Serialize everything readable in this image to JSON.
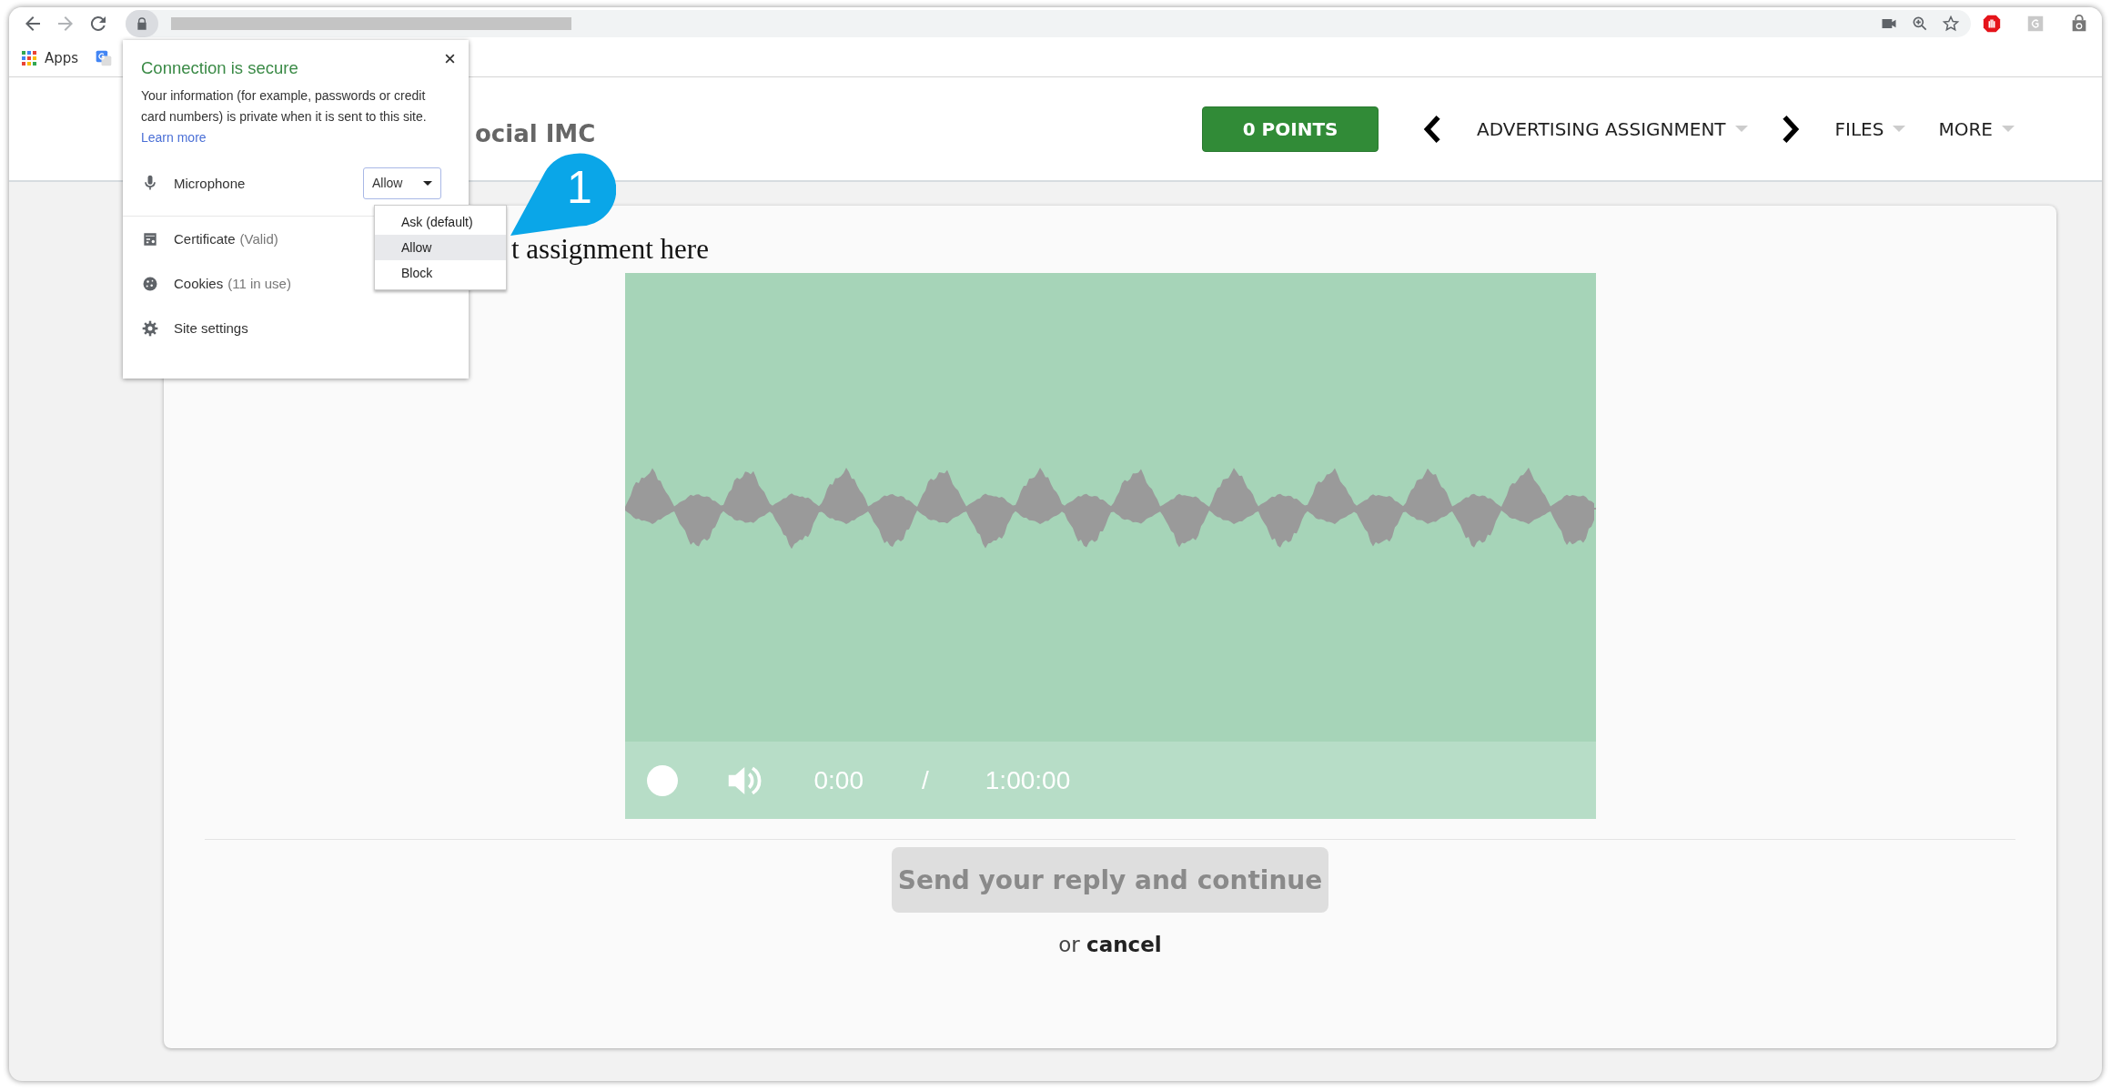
{
  "browser": {
    "bookmarks": [
      {
        "label": "Apps"
      }
    ]
  },
  "header": {
    "title": "ocial IMC",
    "points": "0 POINTS",
    "assignment": "ADVERTISING ASSIGNMENT",
    "menus": [
      {
        "label": "FILES"
      },
      {
        "label": "MORE"
      }
    ]
  },
  "content": {
    "heading": "t assignment here",
    "player": {
      "time_current": "0:00",
      "separator": "/",
      "time_total": "1:00:00"
    },
    "submit": {
      "label": "Send your reply and continue",
      "disabled": true
    },
    "or": "or",
    "cancel": "cancel"
  },
  "site_info_popup": {
    "title": "Connection is secure",
    "body": "Your information (for example, passwords or credit card numbers) is private when it is sent to this site.",
    "link": "Learn more",
    "permission": {
      "label": "Microphone",
      "value": "Allow",
      "options": [
        {
          "label": "Ask (default)",
          "selected": false
        },
        {
          "label": "Allow",
          "selected": true
        },
        {
          "label": "Block",
          "selected": false
        }
      ]
    },
    "items": [
      {
        "kind": "certificate",
        "label": "Certificate",
        "note": "(Valid)"
      },
      {
        "kind": "cookies",
        "label": "Cookies",
        "note": "(11 in use)"
      },
      {
        "kind": "settings",
        "label": "Site settings"
      }
    ]
  },
  "callout": {
    "number": "1"
  }
}
